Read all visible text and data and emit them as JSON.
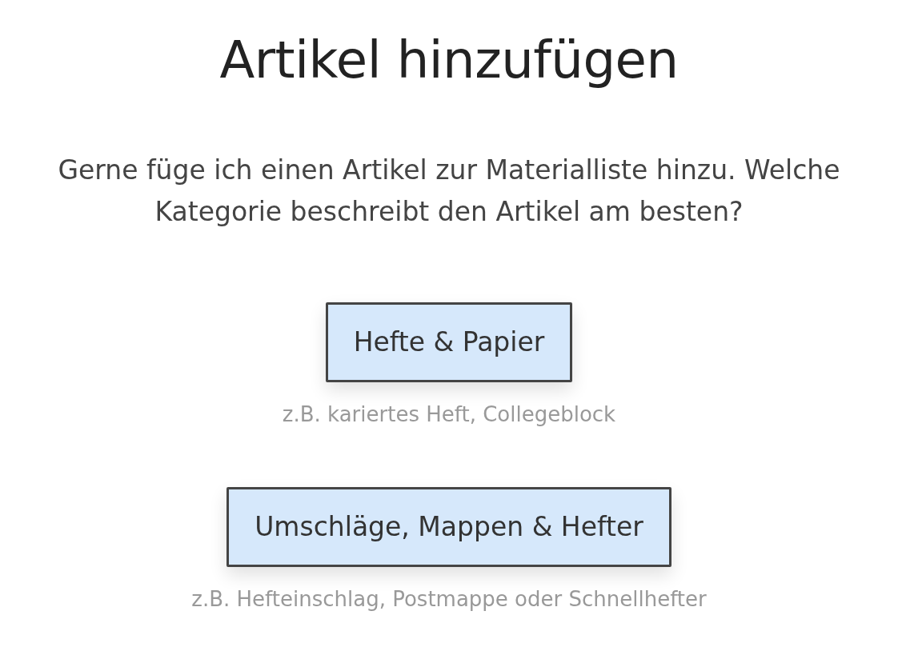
{
  "title": "Artikel hinzufügen",
  "prompt": "Gerne füge ich einen Artikel zur Materialliste hinzu. Welche Kategorie beschreibt den Artikel am besten?",
  "options": [
    {
      "label": "Hefte & Papier",
      "hint": "z.B. kariertes Heft, Collegeblock"
    },
    {
      "label": "Umschläge, Mappen & Hefter",
      "hint": "z.B. Hefteinschlag, Postmappe oder Schnellhefter"
    }
  ]
}
